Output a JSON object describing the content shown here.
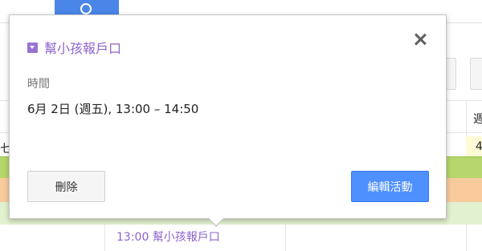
{
  "popup": {
    "title": "幫小孩報戶口",
    "time_label": "時間",
    "time_value": "6月 2日 (週五), 13:00 – 14:50",
    "delete_label": "刪除",
    "edit_label": "編輯活動",
    "accent_color": "#8e63ce",
    "primary_button_color": "#4d90fe"
  },
  "calendar": {
    "event_text": "13:00 幫小孩報戶口",
    "left_fragment": "七",
    "right_header_fragment": "週",
    "right_date_fragment": "4",
    "row_colors": [
      "#b5d76c",
      "#f9cb9c",
      "#e2f1cf"
    ]
  }
}
